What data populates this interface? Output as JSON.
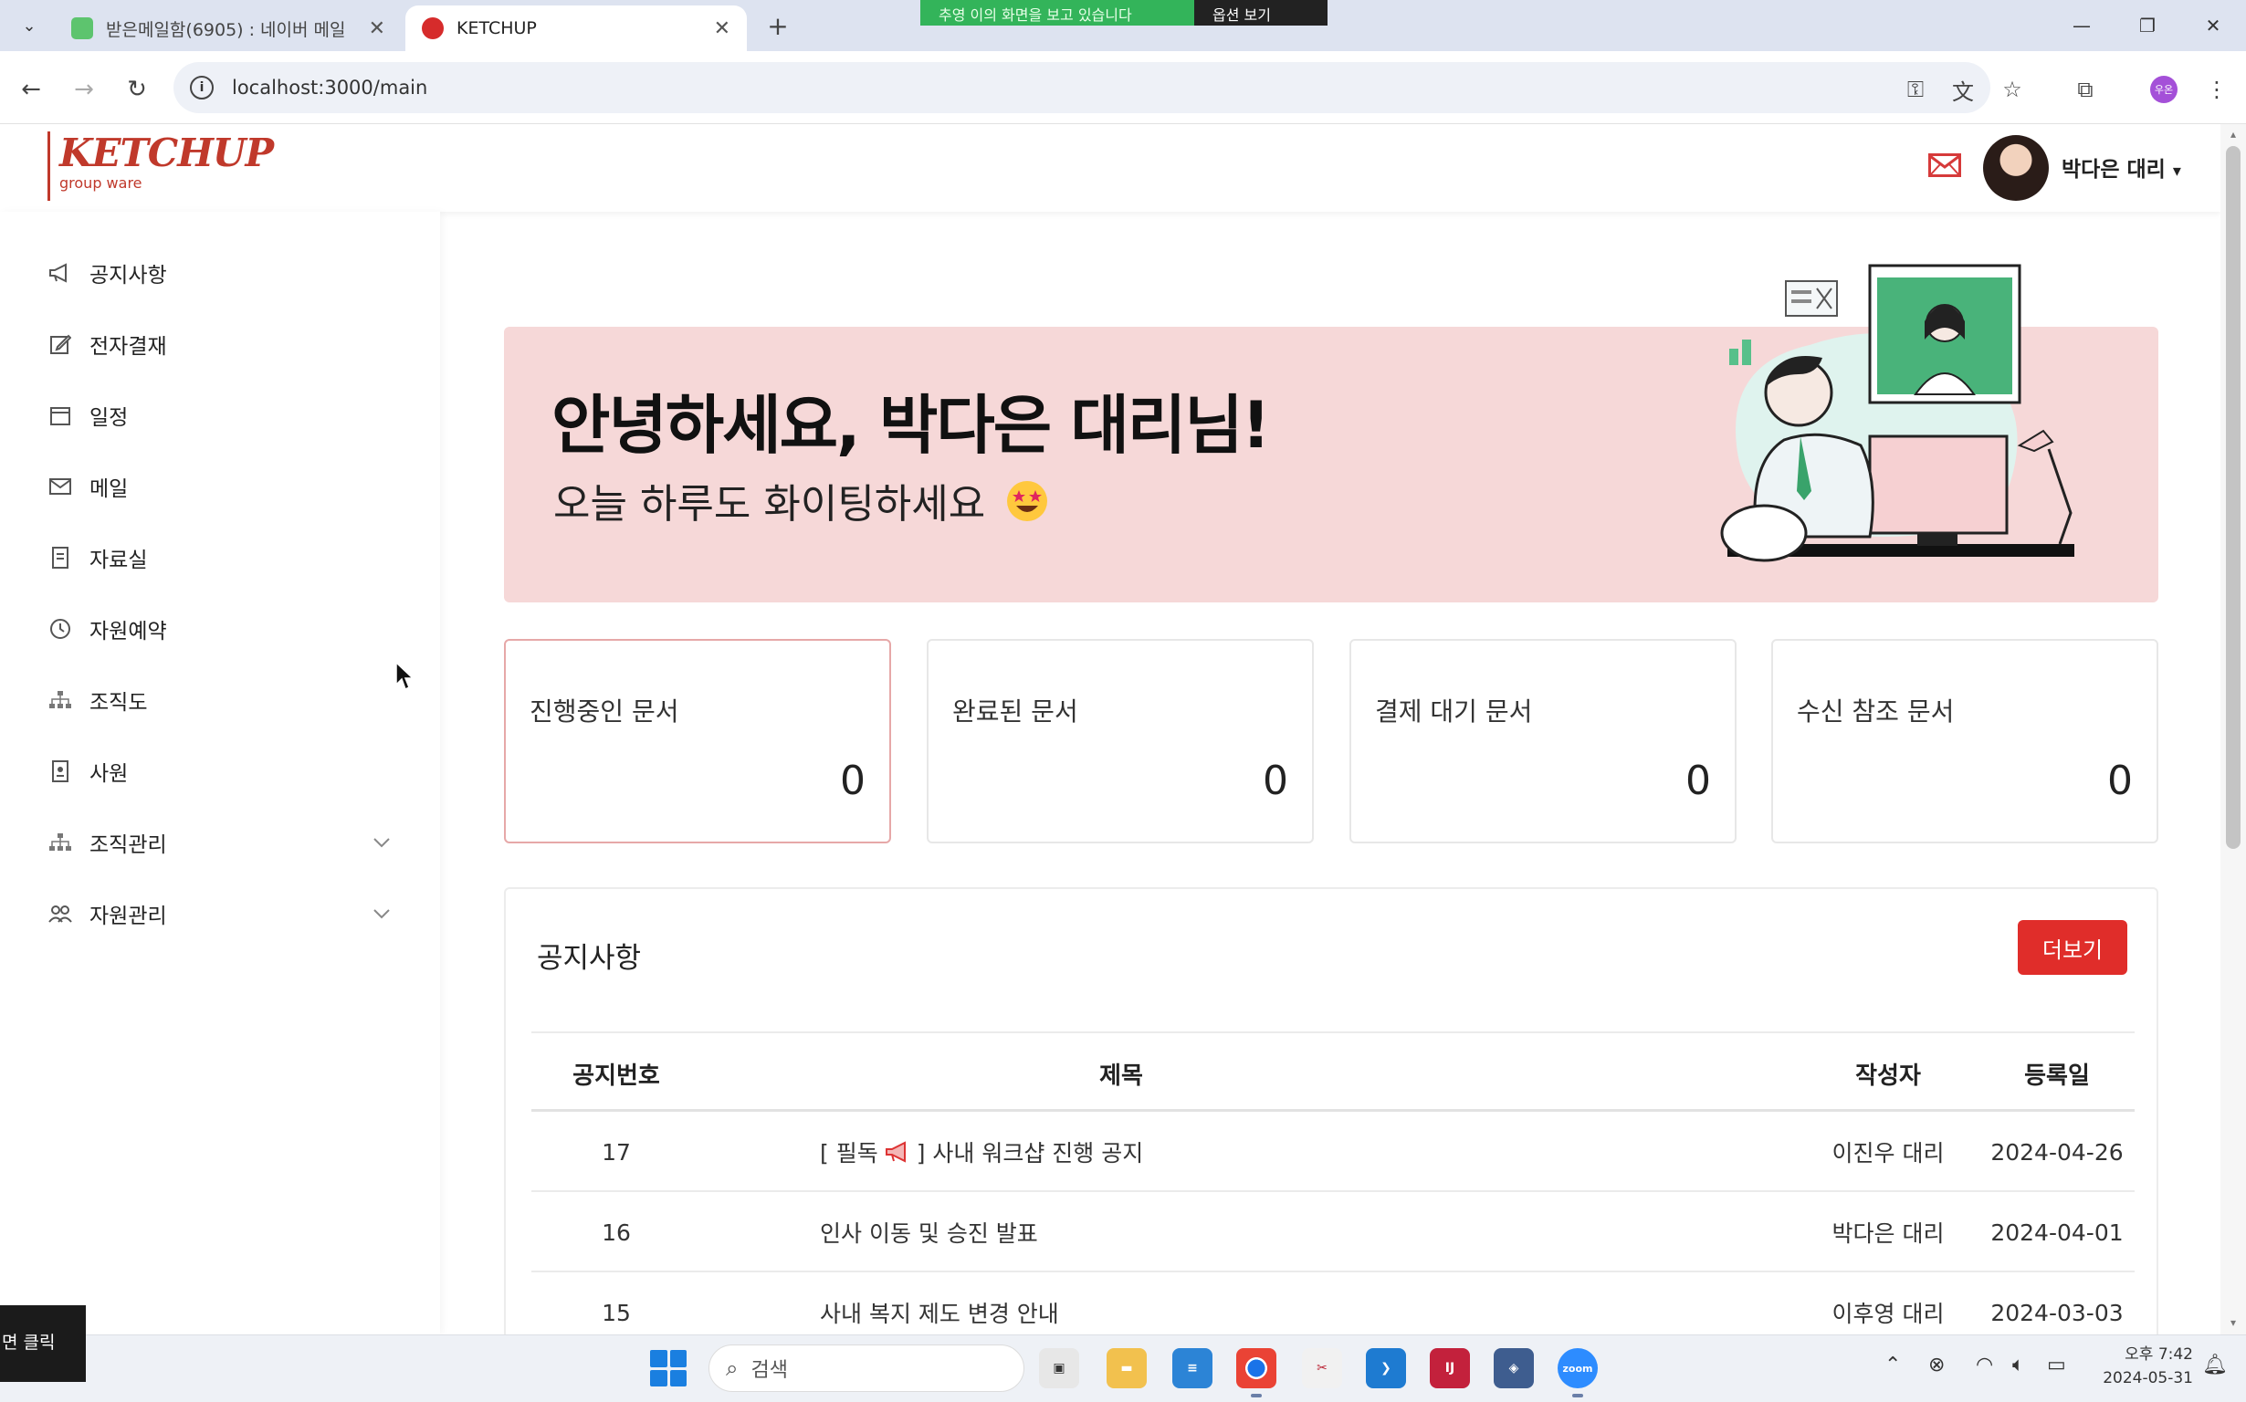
{
  "browser": {
    "tabs": [
      {
        "title": "받은메일함(6905) : 네이버 메일",
        "favicon": "naver-mail-icon",
        "active": false
      },
      {
        "title": "KETCHUP",
        "favicon": "ketchup-icon",
        "active": true
      }
    ],
    "share_bar": {
      "message": "추영 이의 화면을 보고 있습니다",
      "option": "옵션 보기"
    },
    "url": "localhost:3000/main",
    "profile_initials": "우온"
  },
  "app": {
    "logo_main": "KETCHUP",
    "logo_sub": "group ware",
    "user_name": "박다은 대리",
    "user_caret": "▾",
    "brand_color": "#c0392b"
  },
  "sidebar": {
    "items": [
      {
        "label": "공지사항",
        "icon": "megaphone-icon",
        "expandable": false
      },
      {
        "label": "전자결재",
        "icon": "edit-icon",
        "expandable": false
      },
      {
        "label": "일정",
        "icon": "calendar-icon",
        "expandable": false
      },
      {
        "label": "메일",
        "icon": "mail-icon",
        "expandable": false
      },
      {
        "label": "자료실",
        "icon": "document-icon",
        "expandable": false
      },
      {
        "label": "자원예약",
        "icon": "clock-icon",
        "expandable": false
      },
      {
        "label": "조직도",
        "icon": "org-chart-icon",
        "expandable": false
      },
      {
        "label": "사원",
        "icon": "id-badge-icon",
        "expandable": false
      },
      {
        "label": "조직관리",
        "icon": "org-chart-icon",
        "expandable": true
      },
      {
        "label": "자원관리",
        "icon": "users-icon",
        "expandable": true
      }
    ]
  },
  "banner": {
    "greeting": "안녕하세요, 박다은 대리님!",
    "subgreeting": "오늘 하루도 화이팅하세요",
    "background": "#f6d8d8"
  },
  "cards": [
    {
      "label": "진행중인 문서",
      "value": "0"
    },
    {
      "label": "완료된 문서",
      "value": "0"
    },
    {
      "label": "결제 대기 문서",
      "value": "0"
    },
    {
      "label": "수신 참조 문서",
      "value": "0"
    }
  ],
  "notices": {
    "title": "공지사항",
    "more_label": "더보기",
    "headers": {
      "number": "공지번호",
      "title": "제목",
      "author": "작성자",
      "date": "등록일"
    },
    "rows": [
      {
        "number": "17",
        "title_prefix": "[ 필독",
        "title_suffix": "] 사내 워크샵 진행 공지",
        "author": "이진우 대리",
        "date": "2024-04-26"
      },
      {
        "number": "16",
        "title": "인사 이동 및 승진 발표",
        "author": "박다은 대리",
        "date": "2024-04-01"
      },
      {
        "number": "15",
        "title": "사내 복지 제도 변경 안내",
        "author": "이후영 대리",
        "date": "2024-03-03"
      }
    ]
  },
  "taskbar": {
    "tooltip": "면 클릭",
    "search_placeholder": "검색",
    "clock_ampm_time": "오후 7:42",
    "clock_date": "2024-05-31",
    "zoom_label": "zoom"
  }
}
